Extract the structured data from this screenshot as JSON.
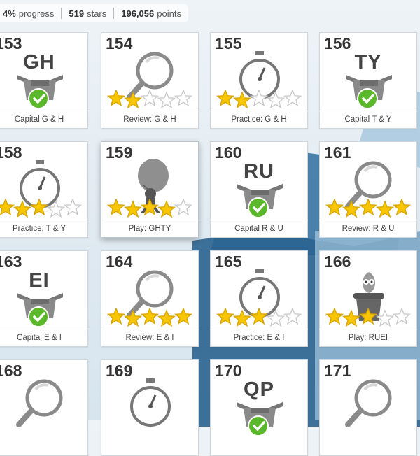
{
  "header": {
    "progress": "4%",
    "progress_label": "progress",
    "stars": "519",
    "stars_label": "stars",
    "points": "196,056",
    "points_label": "points"
  },
  "colors": {
    "check_green": "#5bb82b",
    "star_gold": "#f7c600",
    "card_border": "#cfd6dc"
  },
  "cards": [
    {
      "number": "153",
      "type": "capital",
      "letters": "GH",
      "label": "Capital G & H",
      "icon": "check-box-icon"
    },
    {
      "number": "154",
      "type": "review",
      "label": "Review: G & H",
      "icon": "magnifier-icon",
      "stars": 2
    },
    {
      "number": "155",
      "type": "practice",
      "label": "Practice: G & H",
      "icon": "stopwatch-icon",
      "stars": 2
    },
    {
      "number": "156",
      "type": "capital",
      "letters": "TY",
      "label": "Capital T & Y",
      "icon": "check-box-icon"
    },
    {
      "number": "158",
      "type": "practice",
      "label": "Practice: T & Y",
      "icon": "stopwatch-icon",
      "stars": 3
    },
    {
      "number": "159",
      "type": "play",
      "label": "Play: GHTY",
      "icon": "balloon-ninja-icon",
      "stars": 4
    },
    {
      "number": "160",
      "type": "capital",
      "letters": "RU",
      "label": "Capital R & U",
      "icon": "check-box-icon"
    },
    {
      "number": "161",
      "type": "review",
      "label": "Review: R & U",
      "icon": "magnifier-icon",
      "stars": 5
    },
    {
      "number": "163",
      "type": "capital",
      "letters": "EI",
      "label": "Capital E & I",
      "icon": "check-box-icon"
    },
    {
      "number": "164",
      "type": "review",
      "label": "Review: E & I",
      "icon": "magnifier-icon",
      "stars": 5
    },
    {
      "number": "165",
      "type": "practice",
      "label": "Practice: E & I",
      "icon": "stopwatch-icon",
      "stars": 3
    },
    {
      "number": "166",
      "type": "play",
      "label": "Play: RUEI",
      "icon": "pot-creature-icon",
      "stars": 3
    },
    {
      "number": "168",
      "type": "review",
      "label": "",
      "icon": "magnifier-icon"
    },
    {
      "number": "169",
      "type": "practice",
      "label": "",
      "icon": "stopwatch-icon"
    },
    {
      "number": "170",
      "type": "capital",
      "letters": "QP",
      "label": "",
      "icon": "check-box-icon"
    },
    {
      "number": "171",
      "type": "review",
      "label": "",
      "icon": "magnifier-icon"
    }
  ]
}
